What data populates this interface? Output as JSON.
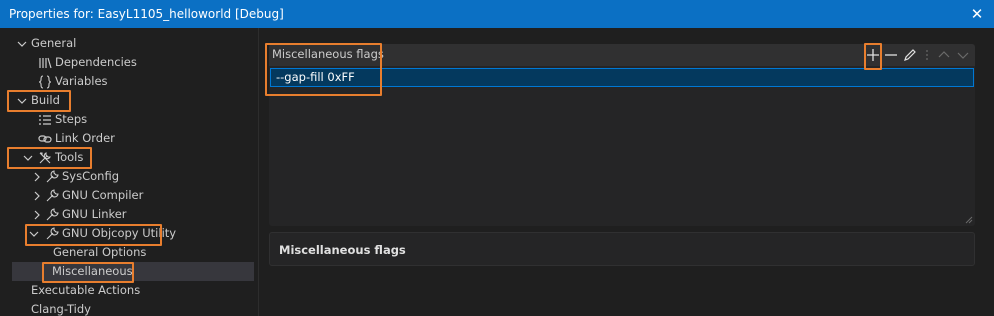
{
  "window": {
    "title": "Properties for: EasyL1105_helloworld [Debug]",
    "close_glyph": "✕"
  },
  "tree": {
    "general": "General",
    "dependencies": "Dependencies",
    "variables": "Variables",
    "build": "Build",
    "steps": "Steps",
    "link_order": "Link Order",
    "tools": "Tools",
    "sysconfig": "SysConfig",
    "gnu_compiler": "GNU Compiler",
    "gnu_linker": "GNU Linker",
    "gnu_objcopy": "GNU Objcopy Utility",
    "general_options": "General Options",
    "miscellaneous": "Miscellaneous",
    "executable_actions": "Executable Actions",
    "clang_tidy": "Clang-Tidy"
  },
  "panel": {
    "title": "Miscellaneous flags",
    "items": [
      "--gap-fill 0xFF"
    ]
  },
  "description": {
    "title": "Miscellaneous flags"
  },
  "colors": {
    "accent": "#0b70c4",
    "highlight": "#e87e2e",
    "selection": "#04395e"
  }
}
